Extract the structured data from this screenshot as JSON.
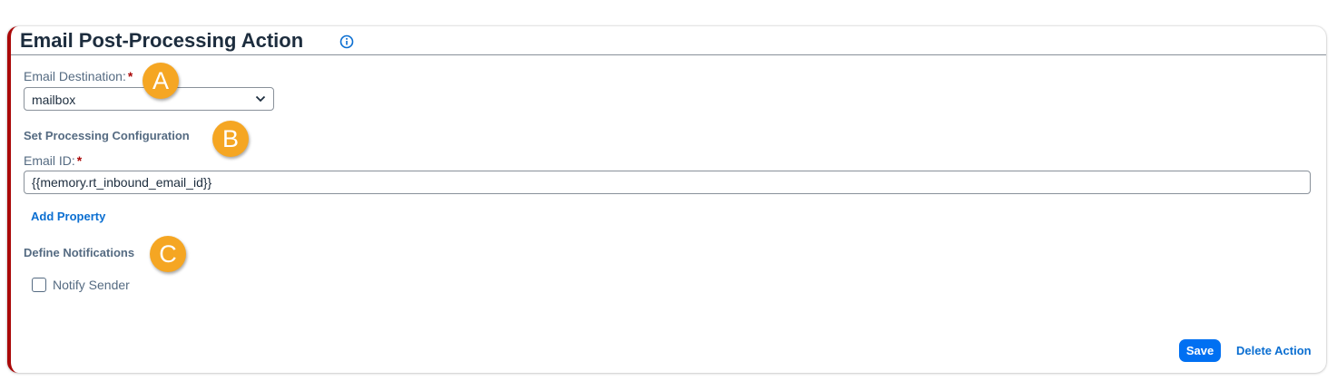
{
  "card": {
    "title": "Email Post-Processing Action",
    "accent_color": "#aa0808"
  },
  "email_destination": {
    "label": "Email Destination:",
    "required_mark": "*",
    "selected_value": "mailbox"
  },
  "processing": {
    "section_title": "Set Processing Configuration",
    "email_id_label": "Email ID:",
    "required_mark": "*",
    "email_id_value": "{{memory.rt_inbound_email_id}}",
    "add_property_label": "Add Property"
  },
  "notifications": {
    "section_title": "Define Notifications",
    "notify_sender_label": "Notify Sender",
    "notify_sender_checked": false
  },
  "footer": {
    "save_label": "Save",
    "delete_label": "Delete Action",
    "primary_color": "#0070f2"
  },
  "markers": {
    "a": "A",
    "b": "B",
    "c": "C",
    "color": "#f5a623"
  }
}
